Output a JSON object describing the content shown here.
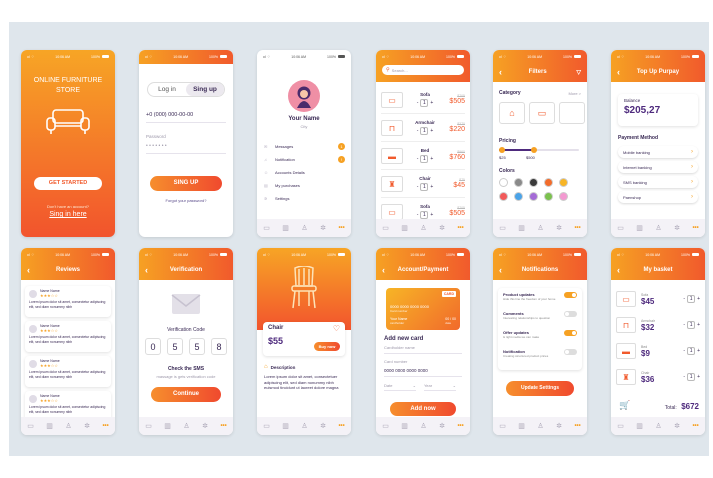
{
  "status": {
    "time": "10:06 AM",
    "battery": "100%"
  },
  "nav_icons": [
    "sofa-icon",
    "store-icon",
    "user-icon",
    "gear-icon"
  ],
  "nav_more": "•••",
  "s1": {
    "title": "ONLINE FURNITURE STORE",
    "cta": "GET STARTED",
    "q": "Don't have an account?",
    "link": "Sing in here"
  },
  "s2": {
    "tab_login": "Log in",
    "tab_signup": "Sing up",
    "phone": "+0 (000) 000-00-00",
    "password_label": "Password",
    "password_mask": "• • • • • • •",
    "cta": "SING UP",
    "forgot": "Forgot your password?"
  },
  "s3": {
    "name": "Your Name",
    "city": "City",
    "menu": [
      {
        "label": "Messages",
        "badge": "1"
      },
      {
        "label": "Notification",
        "badge": "!"
      },
      {
        "label": "Accounts Details",
        "badge": ""
      },
      {
        "label": "My purchases",
        "badge": ""
      },
      {
        "label": "Settings",
        "badge": ""
      }
    ]
  },
  "s4": {
    "search_placeholder": "Search...",
    "items": [
      {
        "name": "Sofa",
        "old": "$705",
        "price": "$505",
        "qty": "1"
      },
      {
        "name": "Armchair",
        "old": "$370",
        "price": "$220",
        "qty": "1"
      },
      {
        "name": "Bed",
        "old": "$960",
        "price": "$760",
        "qty": "1"
      },
      {
        "name": "Chair",
        "old": "$75",
        "price": "$45",
        "qty": "1"
      },
      {
        "name": "Sofa",
        "old": "$705",
        "price": "$505",
        "qty": "1"
      }
    ]
  },
  "s5": {
    "title": "Filters",
    "category": "Category",
    "more": "More >",
    "pricing": "Pricing",
    "min": "$25",
    "max": "$500",
    "colors_label": "Colors",
    "colors": [
      "#ffffff",
      "#8a8a8a",
      "#3a3a3a",
      "#f26c2b",
      "#f7b526",
      "#f15a5a",
      "#4aa3e8",
      "#a46bd6",
      "#7bc14e",
      "#f39ad1"
    ]
  },
  "s6": {
    "title": "Top Up Purpay",
    "balance_label": "Balance",
    "balance": "$205,27",
    "method_title": "Payment Method",
    "methods": [
      "Mobile banking",
      "Internet banking",
      "SMS banking",
      "Paenshop"
    ]
  },
  "s7": {
    "title": "Reviews",
    "reviews": [
      {
        "name": "Name Name",
        "stars": "★★★☆☆",
        "text": "Lorem ipsum dolor sit amet, consectetur adipiscing elit, sed diam nonummy nibh"
      },
      {
        "name": "Name Name",
        "stars": "★★★☆☆",
        "text": "Lorem ipsum dolor sit amet, consectetur adipiscing elit, sed diam nonummy nibh"
      },
      {
        "name": "Name Name",
        "stars": "★★★☆☆",
        "text": "Lorem ipsum dolor sit amet, consectetur adipiscing elit, sed diam nonummy nibh"
      },
      {
        "name": "Name Name",
        "stars": "★★★☆☆",
        "text": "Lorem ipsum dolor sit amet, consectetur adipiscing elit, sed diam nonummy nibh"
      }
    ]
  },
  "s8": {
    "title": "Verification",
    "code_label": "Verification Code",
    "digits": [
      "0",
      "5",
      "5",
      "8"
    ],
    "check": "Check the SMS",
    "msg": "massage is gets verification code",
    "cta": "Continue"
  },
  "s9": {
    "name": "Chair",
    "price": "$55",
    "buy": "Buy now",
    "desc_title": "Description",
    "desc": "Lorem ipsum dolor sit amet, consectetuer adipiscing elit, sed diam nonummy nibh euismod tincidunt ut laoreet dolore magna"
  },
  "s10": {
    "title": "Account/Payment",
    "card_brand": "CARD",
    "card_number_big": "0000 0000 0000 0000",
    "card_number_label": "Card number",
    "holder_name": "Your Name",
    "holder_label": "cardholder",
    "exp": "00 / 00",
    "exp_label": "date",
    "add_title": "Add new card",
    "holder_field": "Cardholder name",
    "number_field": "Card number",
    "number_value": "0000 0000 0000 0000",
    "date_field": "Date",
    "year_field": "Year",
    "cta": "Add now"
  },
  "s11": {
    "title": "Notifications",
    "items": [
      {
        "title": "Product updates",
        "text": "Hide this line the freedom of your home",
        "on": true
      },
      {
        "title": "Comments",
        "text": "Interesting relationships to question",
        "on": false
      },
      {
        "title": "Offer updates",
        "text": "& right media we can make",
        "on": true
      },
      {
        "title": "Notification",
        "text": "Creating structured product prices",
        "on": false
      }
    ],
    "cta": "Update Settings"
  },
  "s12": {
    "title": "My basket",
    "items": [
      {
        "name": "Sofa",
        "price": "$45",
        "qty": "1"
      },
      {
        "name": "Armchair",
        "price": "$32",
        "qty": "1"
      },
      {
        "name": "Bed",
        "price": "$9",
        "qty": "1"
      },
      {
        "name": "Chair",
        "price": "$36",
        "qty": "1"
      }
    ],
    "total_label": "Total:",
    "total": "$672"
  }
}
